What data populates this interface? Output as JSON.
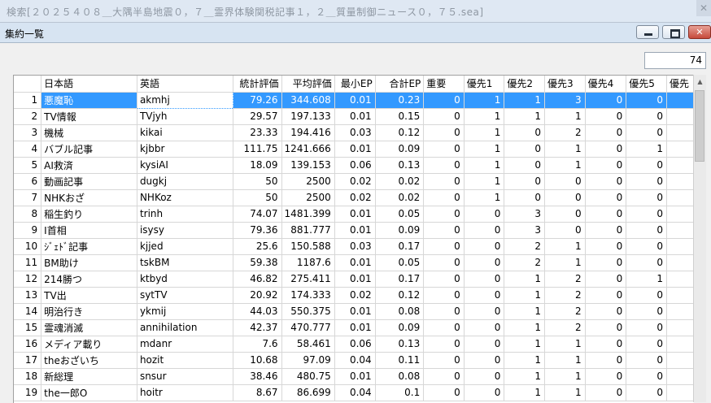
{
  "outer_window": {
    "title": "検索[２０２５４０８＿大隅半島地震０，７＿霊界体験関税記事１，２＿質量制御ニュース０，７５.sea]",
    "close_glyph": "✕"
  },
  "inner_window": {
    "title": "集約一覧",
    "close_glyph": "✕"
  },
  "count": "74",
  "table": {
    "columns": [
      "",
      "日本語",
      "英語",
      "統計評価",
      "平均評価",
      "最小EP",
      "合計EP",
      "重要",
      "優先1",
      "優先2",
      "優先3",
      "優先4",
      "優先5",
      "優先"
    ],
    "rows": [
      [
        "1",
        "悪魔恥",
        "akmhj",
        "79.26",
        "344.608",
        "0.01",
        "0.23",
        "0",
        "1",
        "1",
        "3",
        "0",
        "0",
        ""
      ],
      [
        "2",
        "TV情報",
        "TVjyh",
        "29.57",
        "197.133",
        "0.01",
        "0.15",
        "0",
        "1",
        "1",
        "1",
        "0",
        "0",
        ""
      ],
      [
        "3",
        "機械",
        "kikai",
        "23.33",
        "194.416",
        "0.03",
        "0.12",
        "0",
        "1",
        "0",
        "2",
        "0",
        "0",
        ""
      ],
      [
        "4",
        "バブル記事",
        "kjbbr",
        "111.75",
        "1241.666",
        "0.01",
        "0.09",
        "0",
        "1",
        "0",
        "1",
        "0",
        "1",
        ""
      ],
      [
        "5",
        "AI救済",
        "kysiAI",
        "18.09",
        "139.153",
        "0.06",
        "0.13",
        "0",
        "1",
        "0",
        "1",
        "0",
        "0",
        ""
      ],
      [
        "6",
        "動画記事",
        "dugkj",
        "50",
        "2500",
        "0.02",
        "0.02",
        "0",
        "1",
        "0",
        "0",
        "0",
        "0",
        ""
      ],
      [
        "7",
        "NHKおざ",
        "NHKoz",
        "50",
        "2500",
        "0.02",
        "0.02",
        "0",
        "1",
        "0",
        "0",
        "0",
        "0",
        ""
      ],
      [
        "8",
        "稲生釣り",
        "trinh",
        "74.07",
        "1481.399",
        "0.01",
        "0.05",
        "0",
        "0",
        "3",
        "0",
        "0",
        "0",
        ""
      ],
      [
        "9",
        "I首相",
        "isysy",
        "79.36",
        "881.777",
        "0.01",
        "0.09",
        "0",
        "0",
        "3",
        "0",
        "0",
        "0",
        ""
      ],
      [
        "10",
        "ｼﾞｪﾄﾞ記事",
        "kjjed",
        "25.6",
        "150.588",
        "0.03",
        "0.17",
        "0",
        "0",
        "2",
        "1",
        "0",
        "0",
        ""
      ],
      [
        "11",
        "BM助け",
        "tskBM",
        "59.38",
        "1187.6",
        "0.01",
        "0.05",
        "0",
        "0",
        "2",
        "1",
        "0",
        "0",
        ""
      ],
      [
        "12",
        "214勝つ",
        "ktbyd",
        "46.82",
        "275.411",
        "0.01",
        "0.17",
        "0",
        "0",
        "1",
        "2",
        "0",
        "1",
        ""
      ],
      [
        "13",
        "TV出",
        "sytTV",
        "20.92",
        "174.333",
        "0.02",
        "0.12",
        "0",
        "0",
        "1",
        "2",
        "0",
        "0",
        ""
      ],
      [
        "14",
        "明治行き",
        "ykmij",
        "44.03",
        "550.375",
        "0.01",
        "0.08",
        "0",
        "0",
        "1",
        "2",
        "0",
        "0",
        ""
      ],
      [
        "15",
        "霊魂消滅",
        "annihilation",
        "42.37",
        "470.777",
        "0.01",
        "0.09",
        "0",
        "0",
        "1",
        "2",
        "0",
        "0",
        ""
      ],
      [
        "16",
        "メディア載り",
        "mdanr",
        "7.6",
        "58.461",
        "0.06",
        "0.13",
        "0",
        "0",
        "1",
        "1",
        "0",
        "0",
        ""
      ],
      [
        "17",
        "theおざいち",
        "hozit",
        "10.68",
        "97.09",
        "0.04",
        "0.11",
        "0",
        "0",
        "1",
        "1",
        "0",
        "0",
        ""
      ],
      [
        "18",
        "新総理",
        "snsur",
        "38.46",
        "480.75",
        "0.01",
        "0.08",
        "0",
        "0",
        "1",
        "1",
        "0",
        "0",
        ""
      ],
      [
        "19",
        "the一郎O",
        "hoitr",
        "8.67",
        "86.699",
        "0.04",
        "0.1",
        "0",
        "0",
        "1",
        "1",
        "0",
        "0",
        ""
      ]
    ]
  },
  "selected_row": 0,
  "colors": {
    "selection": "#3399ff",
    "title_bar": "#d7e4f2",
    "close_button": "#c64a3b"
  }
}
